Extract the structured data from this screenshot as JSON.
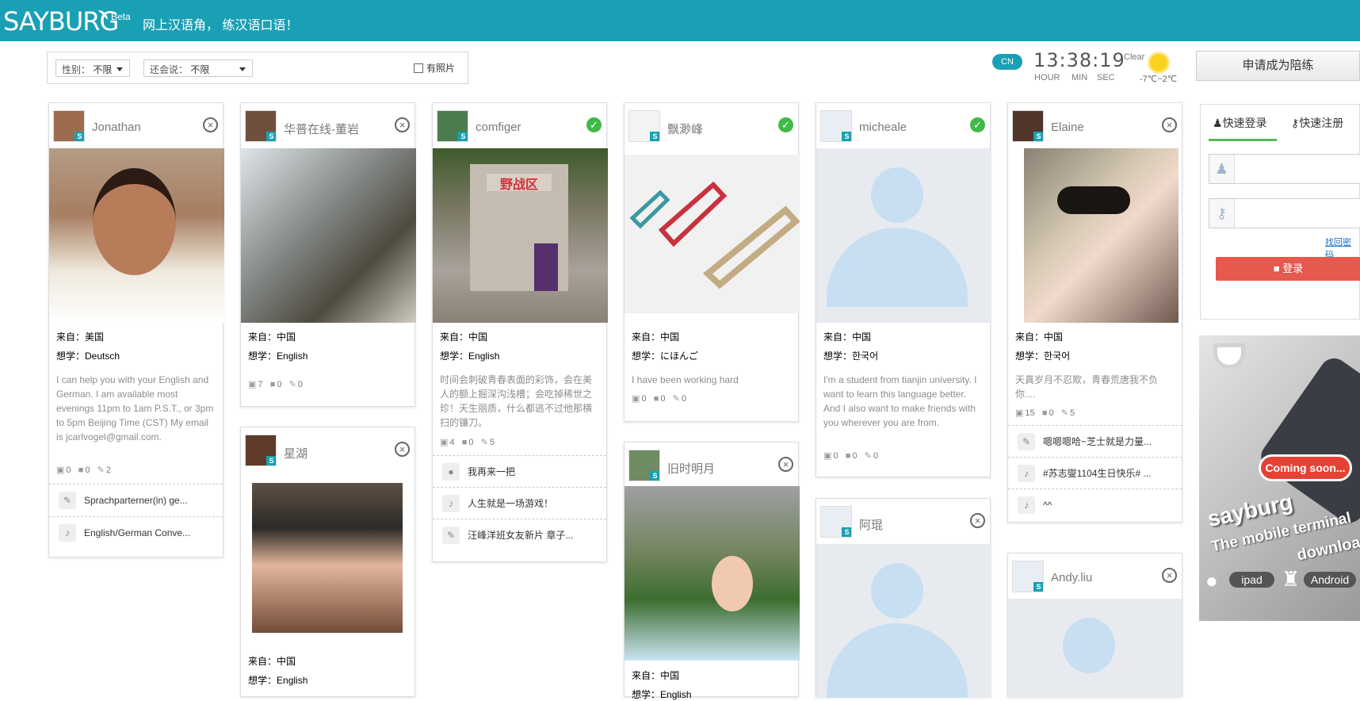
{
  "header": {
    "logo": "SAYBURG",
    "beta": "Beta",
    "slogan": "网上汉语角， 练汉语口语！"
  },
  "filters": {
    "gender_label": "性别：",
    "gender": "不限",
    "speaks_label": "还会说：",
    "speaks": "不限",
    "photo_label": "有照片"
  },
  "status": {
    "lang": "CN",
    "time": "13:38:19",
    "hour": "HOUR",
    "min": "MIN",
    "sec": "SEC",
    "weather": "Clear",
    "temp": "-7℃~2℃",
    "apply": "申请成为陪练"
  },
  "cards": [
    {
      "name": "Jonathan",
      "from": "美国",
      "learn": "Deutsch",
      "bio": "I can help you with your English and German. I am available most evenings 11pm to 1am P.S.T., or 3pm to 5pm Beijing Time (CST) My email is jcarlvogel@gmail.com.",
      "photos": "0",
      "videos": "0",
      "notes": "2",
      "posts": [
        "Sprachparterner(in) ge...",
        "English/German Conve..."
      ]
    },
    {
      "name": "华普在线-董岩",
      "from": "中国",
      "learn": "English",
      "photos": "7",
      "videos": "0",
      "notes": "0"
    },
    {
      "name": "星湖",
      "from": "中国",
      "learn": "English"
    },
    {
      "name": "comfiger",
      "from": "中国",
      "learn": "English",
      "bio": "时间会刺破青春表面的彩饰，会在美人的额上掘深沟浅槽；会吃掉稀世之珍！天生丽质，什么都逃不过他那横扫的镰刀。",
      "photos": "4",
      "videos": "0",
      "notes": "5",
      "posts": [
        "我再来一把",
        "人生就是一场游戏！",
        "汪峰洋班女友新片 章子..."
      ]
    },
    {
      "name": "飘渺峰",
      "from": "中国",
      "learn": "にほんご",
      "bio": "I have been working hard",
      "photos": "0",
      "videos": "0",
      "notes": "0"
    },
    {
      "name": "旧时明月",
      "from": "中国",
      "learn": "English"
    },
    {
      "name": "micheale",
      "from": "中国",
      "learn": "한국어",
      "bio": "I'm a student from tianjin university. I want to learn this language better. And I also want to make friends with you wherever you are from.",
      "photos": "0",
      "videos": "0",
      "notes": "0"
    },
    {
      "name": "阿琨"
    },
    {
      "name": "Elaine",
      "from": "中国",
      "learn": "한국어",
      "bio": "天真岁月不忍欺，青春荒唐我不负你....",
      "photos": "15",
      "videos": "0",
      "notes": "5",
      "posts": [
        "嗯嗯嗯哈~芝士就是力量...",
        "#苏志燮1104生日快乐# ...",
        "^^"
      ]
    },
    {
      "name": "Andy.liu"
    }
  ],
  "labels": {
    "from": "来自：",
    "learn": "想学："
  },
  "login": {
    "tab_login": "快速登录",
    "tab_register": "快速注册",
    "forgot": "找回密码",
    "button": "登录"
  },
  "ad": {
    "coming": "Coming soon...",
    "title": "sayburg",
    "subtitle": "The mobile terminal",
    "download": "download",
    "ipad": "ipad",
    "android": "Android"
  }
}
